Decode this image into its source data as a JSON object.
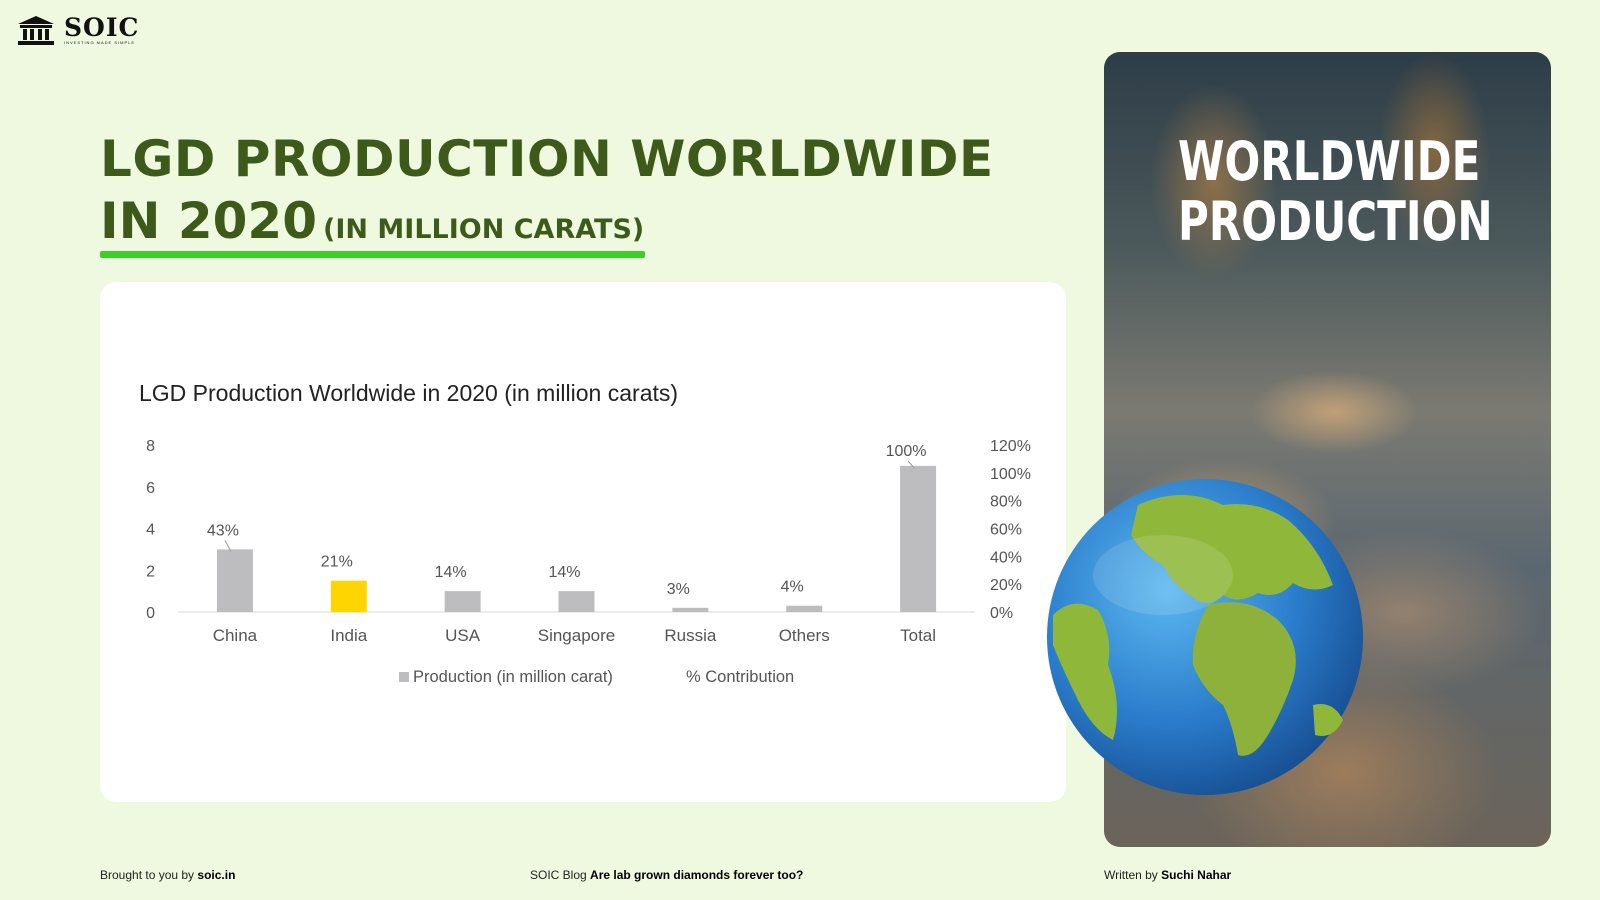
{
  "brand": {
    "name": "SOIC",
    "tagline": "INVESTING MADE SIMPLE"
  },
  "heading": {
    "line1": "LGD PRODUCTION WORLDWIDE",
    "line2": "IN 2020",
    "line2_suffix": "(IN MILLION CARATS)"
  },
  "photo": {
    "title_line1": "WORLDWIDE",
    "title_line2": "PRODUCTION"
  },
  "footer": {
    "brought_prefix": "Brought to you by ",
    "brought_link": "soic.in",
    "blog_prefix": "SOIC Blog ",
    "blog_title": "Are lab grown diamonds forever too?",
    "author_prefix": "Written by ",
    "author_name": "Suchi Nahar"
  },
  "chart_data": {
    "type": "bar",
    "title": "LGD Production Worldwide in 2020 (in million carats)",
    "categories": [
      "China",
      "India",
      "USA",
      "Singapore",
      "Russia",
      "Others",
      "Total"
    ],
    "series": [
      {
        "name": "Production (in million carat)",
        "values": [
          3.0,
          1.5,
          1.0,
          1.0,
          0.2,
          0.3,
          7.0
        ],
        "axis": "left"
      },
      {
        "name": "% Contribution",
        "values": [
          43,
          21,
          14,
          14,
          3,
          4,
          100
        ],
        "axis": "right"
      }
    ],
    "data_labels": [
      "43%",
      "21%",
      "14%",
      "14%",
      "3%",
      "4%",
      "100%"
    ],
    "highlight_index": 1,
    "colors": {
      "bar": "#bdbdbf",
      "highlight": "#ffd500",
      "text": "#444444"
    },
    "left_axis": {
      "ylim": [
        0,
        8
      ],
      "ticks": [
        0,
        2,
        4,
        6,
        8
      ]
    },
    "right_axis": {
      "ylim": [
        0,
        120
      ],
      "ticks": [
        "0%",
        "20%",
        "40%",
        "60%",
        "80%",
        "100%",
        "120%"
      ]
    },
    "legend_position": "bottom"
  }
}
